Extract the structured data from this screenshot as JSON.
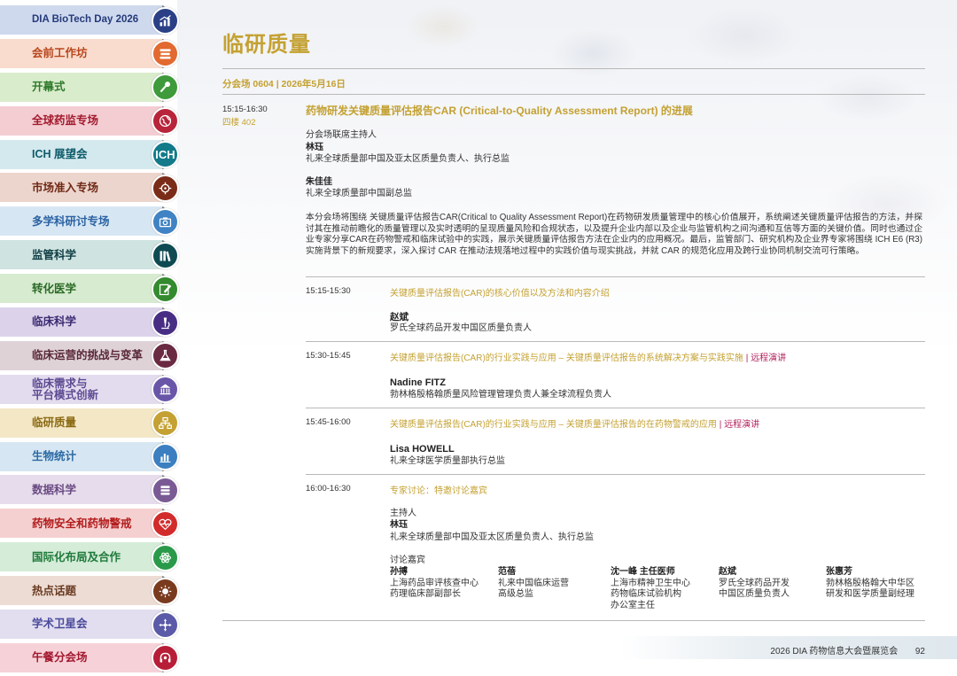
{
  "sidebar": {
    "items": [
      {
        "label": "DIA BioTech Day 2026",
        "bg": "#cfd9ee",
        "fg": "#243a7a",
        "icon_bg": "#2a3f86",
        "icon": "chart-icon"
      },
      {
        "label": "会前工作坊",
        "bg": "#f9dccd",
        "fg": "#b8461d",
        "icon_bg": "#e2692f",
        "icon": "book-stack-icon"
      },
      {
        "label": "开幕式",
        "bg": "#d9eccc",
        "fg": "#2f7a2b",
        "icon_bg": "#3e9a3a",
        "icon": "microphone-icon"
      },
      {
        "label": "全球药监专场",
        "bg": "#f3cdd2",
        "fg": "#a31a2e",
        "icon_bg": "#b8243a",
        "icon": "globe-icon"
      },
      {
        "label": "ICH 展望会",
        "bg": "#d4e9ee",
        "fg": "#0e5b6a",
        "icon_bg": "#137a8a",
        "icon": "ich-icon",
        "icon_text": "ICH"
      },
      {
        "label": "市场准入专场",
        "bg": "#ecd5cc",
        "fg": "#6e2714",
        "icon_bg": "#7a2c18",
        "icon": "target-icon"
      },
      {
        "label": "多学科研讨专场",
        "bg": "#d7e6f3",
        "fg": "#2a62a3",
        "icon_bg": "#3f83c4",
        "icon": "camera-icon"
      },
      {
        "label": "监管科学",
        "bg": "#cfe3e1",
        "fg": "#0f3e44",
        "icon_bg": "#0f4a52",
        "icon": "books-icon"
      },
      {
        "label": "转化医学",
        "bg": "#d6ebcf",
        "fg": "#2b6a27",
        "icon_bg": "#348a2e",
        "icon": "pen-icon"
      },
      {
        "label": "临床科学",
        "bg": "#dcd3ea",
        "fg": "#3d2a72",
        "icon_bg": "#472e84",
        "icon": "microscope-icon"
      },
      {
        "label": "临床运营的挑战与变革",
        "bg": "#ded2d6",
        "fg": "#5a2838",
        "icon_bg": "#6a2a42",
        "icon": "flask-icon"
      },
      {
        "label": "临床需求与|平台模式创新",
        "bg": "#e3dcee",
        "fg": "#5c4a92",
        "icon_bg": "#6a56a8",
        "icon": "building-icon"
      },
      {
        "label": "临研质量",
        "bg": "#f3e7c6",
        "fg": "#8a6a12",
        "icon_bg": "#c4a132",
        "icon": "hierarchy-icon"
      },
      {
        "label": "生物统计",
        "bg": "#d6e6f2",
        "fg": "#2b6aa3",
        "icon_bg": "#3b7fc0",
        "icon": "bar-chart-icon"
      },
      {
        "label": "数据科学",
        "bg": "#e6dcec",
        "fg": "#6a4a82",
        "icon_bg": "#7a5a94",
        "icon": "database-icon"
      },
      {
        "label": "药物安全和药物警戒",
        "bg": "#f5d0d0",
        "fg": "#b31c1c",
        "icon_bg": "#d22b2b",
        "icon": "heartbeat-icon"
      },
      {
        "label": "国际化布局及合作",
        "bg": "#d4ecd8",
        "fg": "#1f7a3a",
        "icon_bg": "#2a9a4a",
        "icon": "atom-icon"
      },
      {
        "label": "热点话题",
        "bg": "#ecdcd3",
        "fg": "#6a3a22",
        "icon_bg": "#7a3a1e",
        "icon": "sun-icon"
      },
      {
        "label": "学术卫星会",
        "bg": "#e2def0",
        "fg": "#4a4a9a",
        "icon_bg": "#5a5aa8",
        "icon": "satellite-icon"
      },
      {
        "label": "午餐分会场",
        "bg": "#f6d2d8",
        "fg": "#a2182f",
        "icon_bg": "#b81d38",
        "icon": "headset-icon"
      }
    ]
  },
  "page_title": "临研质量",
  "session_line": "分会场 0604 | 2026年5月16日",
  "session": {
    "time": "15:15-16:30",
    "room": "四楼 402",
    "title": "药物研发关键质量评估报告CAR (Critical-to-Quality Assessment Report) 的进展",
    "chairs_label": "分会场联席主持人",
    "chairs": [
      {
        "name": "林珏",
        "role": "礼来全球质量部中国及亚太区质量负责人、执行总监"
      },
      {
        "name": "朱佳佳",
        "role": "礼来全球质量部中国副总监"
      }
    ],
    "description": "本分会场将围绕 关键质量评估报告CAR(Critical to Quality Assessment Report)在药物研发质量管理中的核心价值展开，系统阐述关键质量评估报告的方法，并探讨其在推动前瞻化的质量管理以及实时透明的呈现质量风险和合规状态，以及提升企业内部以及企业与监管机构之间沟通和互信等方面的关键价值。同时也通过企业专家分享CAR在药物警戒和临床试验中的实践，展示关键质量评估报告方法在企业内的应用概况。最后，监管部门、研究机构及企业界专家将围绕 ICH E6 (R3) 实施背景下的新规要求，深入探讨 CAR 在推动法规落地过程中的实践价值与现实挑战，并就 CAR 的规范化应用及跨行业协同机制交流可行策略。"
  },
  "talks": [
    {
      "time": "15:15-15:30",
      "title": "关键质量评估报告(CAR)的核心价值以及方法和内容介绍",
      "remote": "",
      "speaker": "赵斌",
      "role": "罗氏全球药品开发中国区质量负责人"
    },
    {
      "time": "15:30-15:45",
      "title": "关键质量评估报告(CAR)的行业实践与应用 – 关键质量评估报告的系统解决方案与实践实施",
      "remote": "远程演讲",
      "speaker": "Nadine FITZ",
      "role": "勃林格殷格翰质量风险管理管理负责人兼全球流程负责人"
    },
    {
      "time": "15:45-16:00",
      "title": "关键质量评估报告(CAR)的行业实践与应用 – 关键质量评估报告的在药物警戒的应用",
      "remote": "远程演讲",
      "speaker": "Lisa HOWELL",
      "role": "礼来全球医学质量部执行总监"
    }
  ],
  "panel": {
    "time": "16:00-16:30",
    "title": "专家讨论：特邀讨论嘉宾",
    "host_label": "主持人",
    "host_name": "林珏",
    "host_role": "礼来全球质量部中国及亚太区质量负责人、执行总监",
    "guests_label": "讨论嘉宾",
    "guests": [
      {
        "name": "孙搏",
        "role1": "上海药品审评核查中心",
        "role2": "药理临床部副部长",
        "role3": ""
      },
      {
        "name": "范蓓",
        "role1": "礼来中国临床运营",
        "role2": "高级总监",
        "role3": ""
      },
      {
        "name": "沈一峰 主任医师",
        "role1": "上海市精神卫生中心",
        "role2": "药物临床试验机构",
        "role3": "办公室主任"
      },
      {
        "name": "赵斌",
        "role1": "罗氏全球药品开发",
        "role2": "中国区质量负责人",
        "role3": ""
      },
      {
        "name": "张惠芳",
        "role1": "勃林格殷格翰大中华区",
        "role2": "研发和医学质量副经理",
        "role3": ""
      }
    ]
  },
  "footer": {
    "text": "2026 DIA 药物信息大会暨展览会",
    "page": "92"
  }
}
